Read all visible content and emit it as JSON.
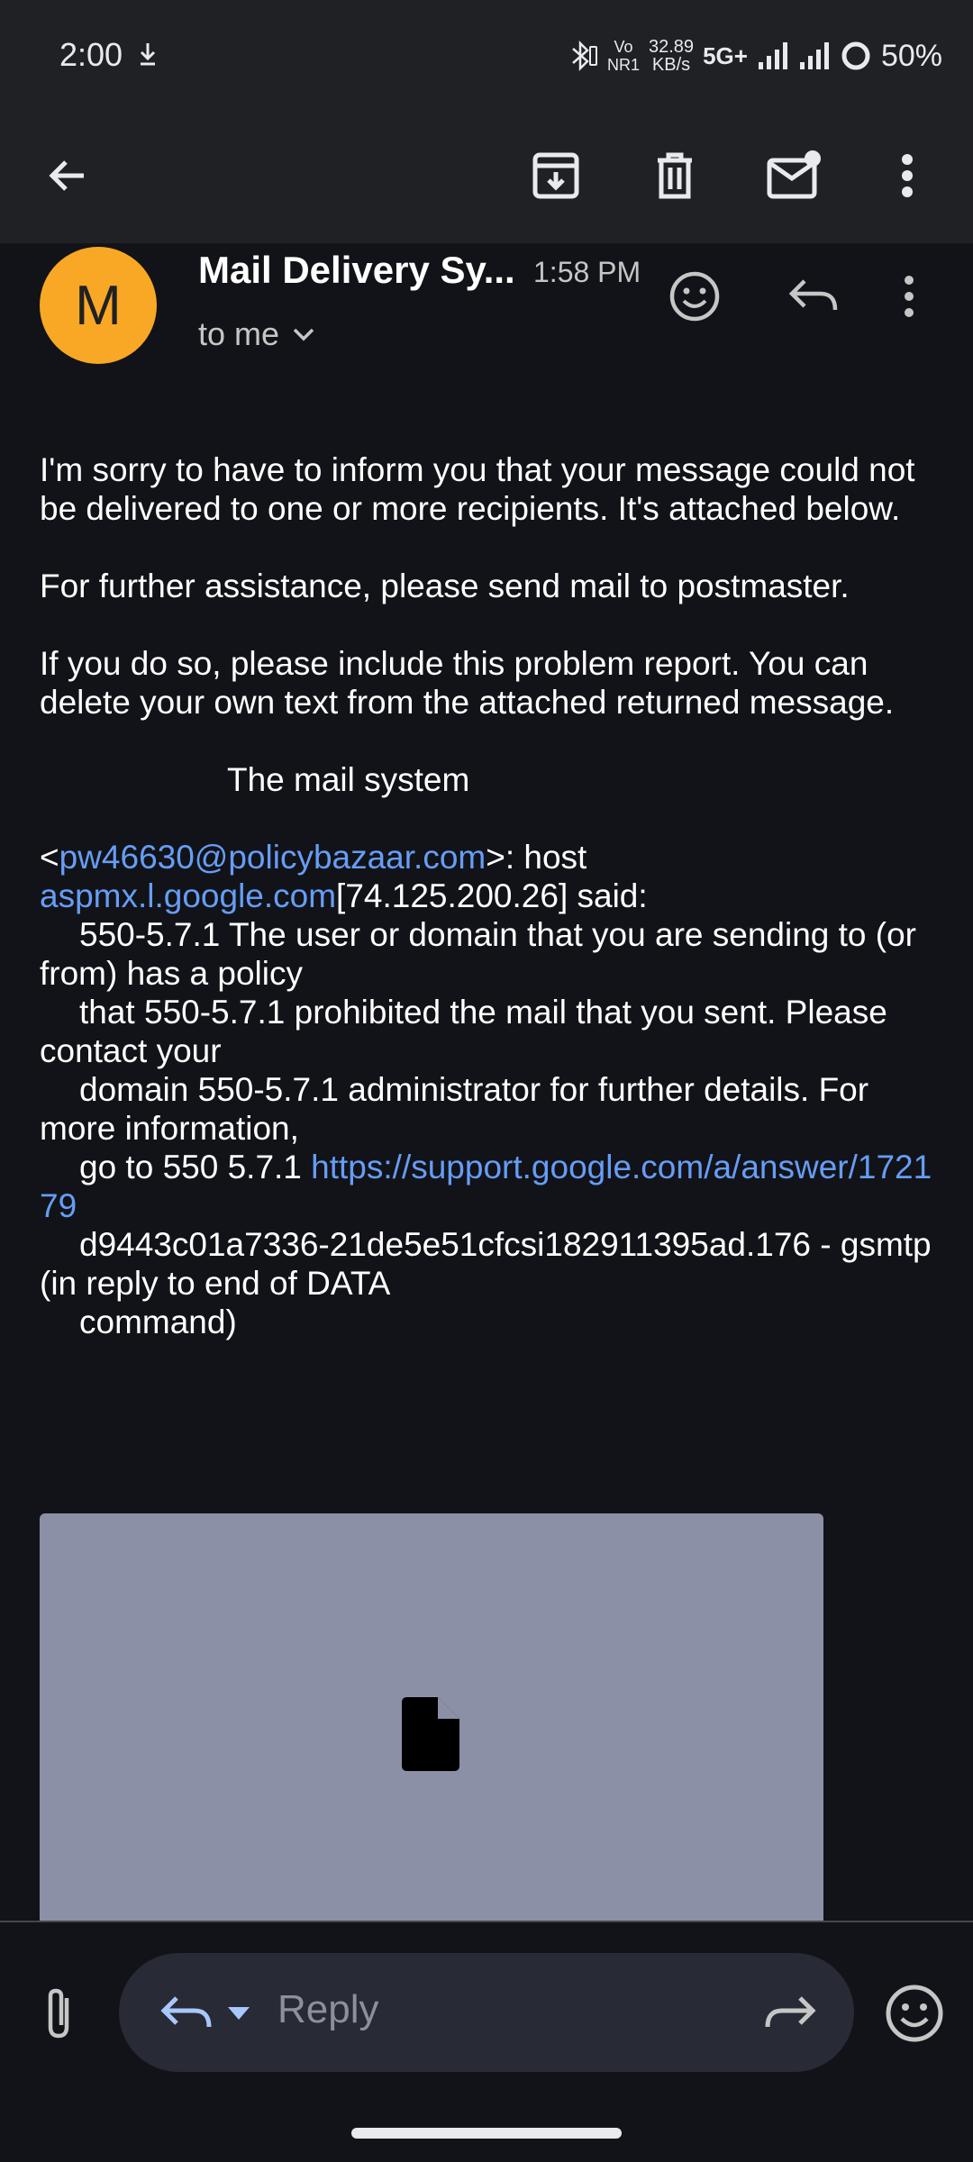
{
  "status_bar": {
    "time": "2:00",
    "network_small_1": "Vo",
    "network_small_2": "NR1",
    "speed_value": "32.89",
    "speed_unit": "KB/s",
    "network_type": "5G+",
    "battery": "50%"
  },
  "email": {
    "sender_initial": "M",
    "sender_name": "Mail Delivery Sy...",
    "time": "1:58 PM",
    "recipient": "to me",
    "body": {
      "line_1": "I'm sorry to have to inform you that your message could not",
      "line_2": "be delivered to one or more recipients. It's attached below.",
      "line_3": "For further assistance, please send mail to postmaster.",
      "line_4": "If you do so, please include this problem report. You can delete your own text from the attached returned message.",
      "line_5": "The mail system",
      "address_open": "<",
      "address_link": "pw46630@policybazaar.com",
      "address_close": ">: host",
      "host_link": "aspmx.l.google.com",
      "host_tail": "[74.125.200.26] said:",
      "err_1": "550-5.7.1 The user or domain that you are sending to (or from) has a policy",
      "err_2": "that 550-5.7.1 prohibited the mail that you sent. Please contact your",
      "err_3": "domain 550-5.7.1 administrator for further details. For more information,",
      "err_4_prefix": "go to 550 5.7.1 ",
      "err_4_link": "https://support.google.com/a/answer/172179",
      "err_5": "d9443c01a7336-21de5e51cfcsi182911395ad.176 - gsmtp (in reply to end of DATA",
      "err_6": "command)"
    }
  },
  "reply_bar": {
    "placeholder": "Reply"
  },
  "icons": {
    "back": "arrow-left-icon",
    "archive": "archive-icon",
    "delete": "trash-icon",
    "mark_unread": "mail-unread-icon",
    "more": "more-vert-icon",
    "react": "emoji-icon",
    "reply": "reply-icon",
    "attach": "paperclip-icon",
    "forward": "forward-icon",
    "file": "file-icon"
  },
  "colors": {
    "background": "#121318",
    "appbar": "#202124",
    "avatar": "#f9a825",
    "link": "#669df6",
    "attachment_bg": "#8b90a6"
  }
}
